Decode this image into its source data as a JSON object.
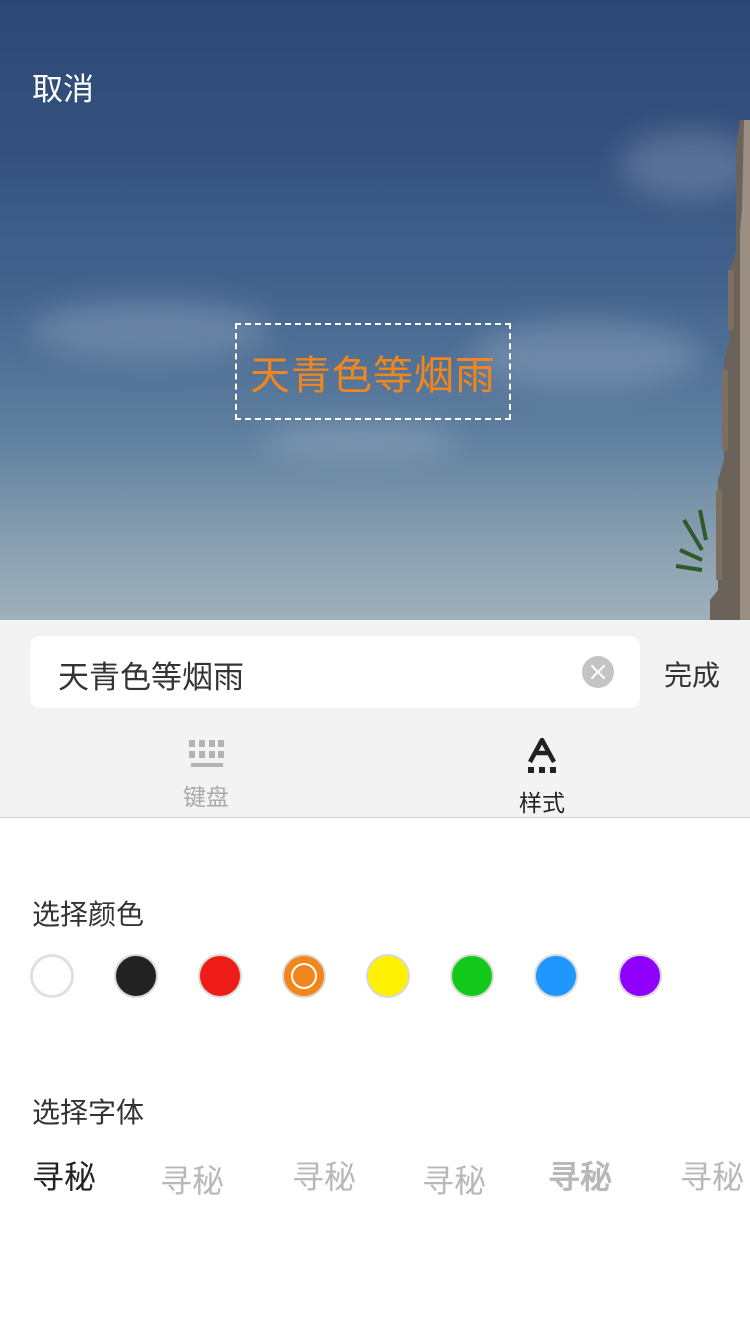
{
  "header": {
    "cancel_label": "取消"
  },
  "canvas": {
    "overlay_text": "天青色等烟雨",
    "overlay_color": "#f0861c"
  },
  "editor": {
    "input_value": "天青色等烟雨",
    "done_label": "完成",
    "tabs": [
      {
        "label": "键盘",
        "icon": "keyboard-icon",
        "active": false
      },
      {
        "label": "样式",
        "icon": "text-style-icon",
        "active": true
      }
    ]
  },
  "colors": {
    "title": "选择颜色",
    "swatches": [
      "#ffffff",
      "#222222",
      "#ee1c14",
      "#f0861c",
      "#fff200",
      "#12c91a",
      "#1e98ff",
      "#9000ff"
    ],
    "selected": "#f0861c"
  },
  "fonts": {
    "title": "选择字体",
    "samples": [
      "寻秘",
      "寻秘",
      "寻秘",
      "寻秘",
      "寻秘",
      "寻秘"
    ]
  }
}
